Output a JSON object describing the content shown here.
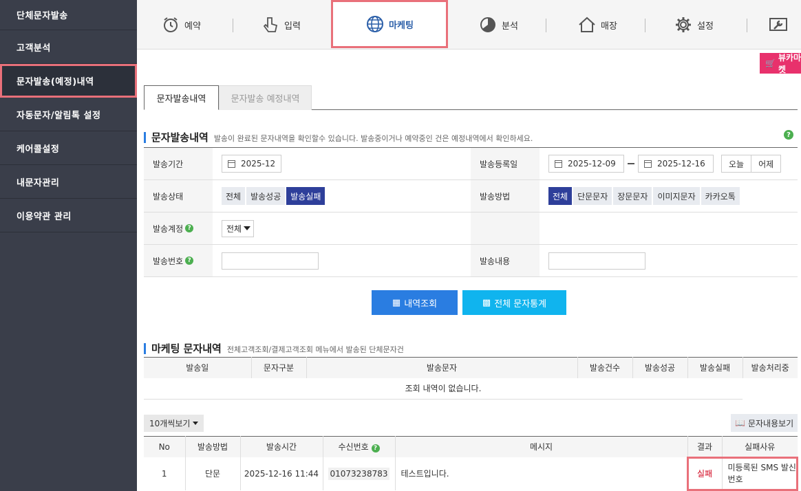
{
  "sidebar": {
    "items": [
      {
        "label": "단체문자발송"
      },
      {
        "label": "고객분석"
      },
      {
        "label": "문자발송(예정)내역"
      },
      {
        "label": "자동문자/알림톡 설정"
      },
      {
        "label": "케어콜설정"
      },
      {
        "label": "내문자관리"
      },
      {
        "label": "이용약관 관리"
      }
    ]
  },
  "topnav": {
    "items": [
      {
        "label": "예약",
        "icon": "alarm-clock-icon"
      },
      {
        "label": "입력",
        "icon": "hand-pointer-icon"
      },
      {
        "label": "마케팅",
        "icon": "globe-icon"
      },
      {
        "label": "분석",
        "icon": "pie-chart-icon"
      },
      {
        "label": "매장",
        "icon": "house-icon"
      },
      {
        "label": "설정",
        "icon": "gear-icon"
      }
    ],
    "cart_label": "뷰카마켓"
  },
  "tabs": [
    {
      "label": "문자발송내역"
    },
    {
      "label": "문자발송 예정내역"
    }
  ],
  "section1": {
    "title": "문자발송내역",
    "desc": "발송이 완료된 문자내역을 확인할수 있습니다. 발송중이거나 예약중인 건은 예정내역에서 확인하세요."
  },
  "form": {
    "period_label": "발송기간",
    "period_value": "2025-12",
    "regdate_label": "발송등록일",
    "regdate_from": "2025-12-09",
    "regdate_to": "2025-12-16",
    "today_btn": "오늘",
    "yesterday_btn": "어제",
    "status_label": "발송상태",
    "status_options": [
      "전체",
      "발송성공",
      "발송실패"
    ],
    "method_label": "발송방법",
    "method_options": [
      "전체",
      "단문문자",
      "장문문자",
      "이미지문자",
      "카카오톡"
    ],
    "account_label": "발송계정",
    "account_value": "전체",
    "number_label": "발송번호",
    "content_label": "발송내용"
  },
  "buttons": {
    "search": "내역조회",
    "stats": "전체 문자통계"
  },
  "section2": {
    "title": "마케팅 문자내역",
    "desc": "전체고객조회/결제고객조회 메뉴에서 발송된 단체문자건"
  },
  "marketing_table": {
    "headers": [
      "발송일",
      "문자구분",
      "발송문자",
      "발송건수",
      "발송성공",
      "발송실패",
      "발송처리중"
    ],
    "empty": "조회 내역이 없습니다."
  },
  "pager_label": "10개씩보기",
  "view_btn": "문자내용보기",
  "msg_table": {
    "headers": [
      "No",
      "발송방법",
      "발송시간",
      "수신번호",
      "메시지",
      "결과",
      "실패사유"
    ],
    "rows": [
      {
        "no": "1",
        "method": "단문",
        "time": "2025-12-16 11:44",
        "receiver": "01073238783",
        "message": "테스트입니다.",
        "result": "실패",
        "reason": "미등록된 SMS 발신번호"
      }
    ]
  },
  "colors": {
    "accent": "#2e3f9a",
    "highlight": "#e9707a",
    "fail": "#d0021b"
  }
}
